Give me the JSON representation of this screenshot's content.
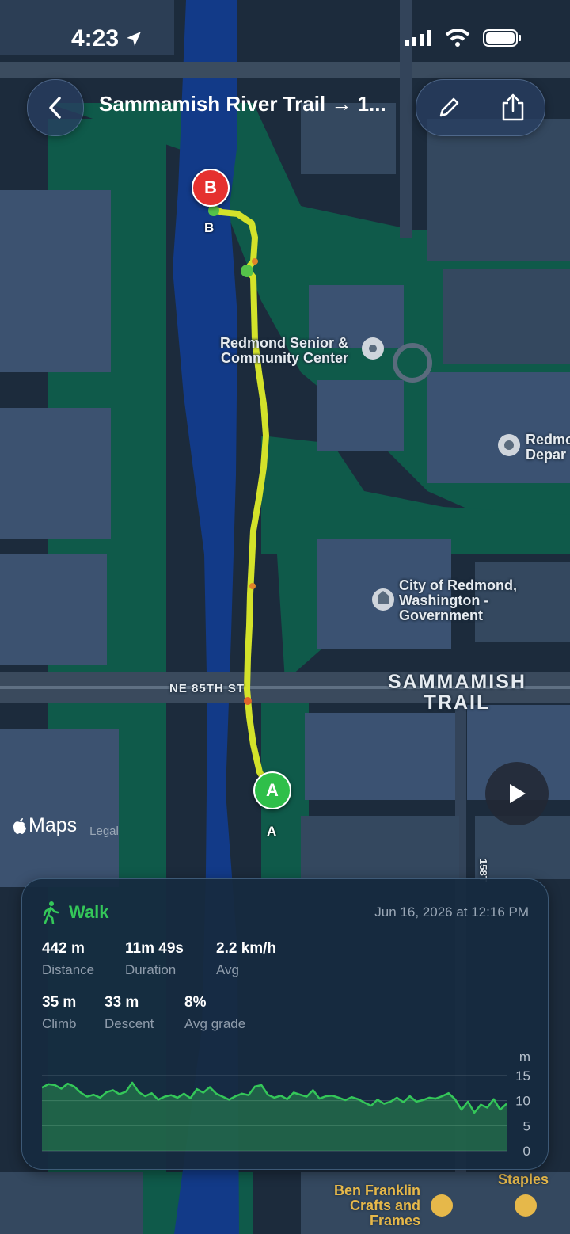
{
  "status_bar": {
    "time": "4:23"
  },
  "header": {
    "title": "Sammamish River Trail → 1..."
  },
  "map": {
    "labels": {
      "senior_center": "Redmond Senior &\nCommunity Center",
      "city_government": "City of Redmond,\nWashington -\nGovernment",
      "police": "Redmo\nDepar",
      "street": "NE 85TH ST",
      "trail": "SAMMAMISH\nTRAIL",
      "street_vertical": "158T",
      "ben_franklin": "Ben Franklin\nCrafts and\nFrames",
      "staples": "Staples"
    },
    "start_marker": "A",
    "end_marker": "B",
    "attribution": {
      "logo": "Maps",
      "legal": "Legal"
    }
  },
  "activity": {
    "type": "Walk",
    "date": "Jun 16, 2026 at 12:16 PM",
    "stats": [
      {
        "value": "442 m",
        "label": "Distance"
      },
      {
        "value": "11m 49s",
        "label": "Duration"
      },
      {
        "value": "2.2 km/h",
        "label": "Avg"
      },
      {
        "value": "35 m",
        "label": "Climb"
      },
      {
        "value": "33 m",
        "label": "Descent"
      },
      {
        "value": "8%",
        "label": "Avg grade"
      }
    ]
  },
  "chart_data": {
    "type": "area",
    "ylabel": "m",
    "ylim": [
      0,
      15
    ],
    "yticks": [
      "15",
      "10",
      "5",
      "0"
    ],
    "values": [
      12.6,
      13.3,
      13.1,
      12.4,
      13.4,
      12.8,
      11.6,
      10.8,
      11.2,
      10.6,
      11.7,
      12.1,
      11.3,
      11.8,
      13.6,
      11.7,
      10.9,
      11.5,
      10.2,
      10.8,
      11.1,
      10.6,
      11.4,
      10.5,
      12.3,
      11.6,
      12.7,
      11.4,
      10.8,
      10.2,
      10.9,
      11.4,
      11.1,
      12.8,
      13.1,
      11.2,
      10.6,
      11.0,
      10.3,
      11.6,
      11.2,
      10.8,
      12.1,
      10.4,
      10.9,
      11.0,
      10.6,
      10.1,
      10.7,
      10.3,
      9.6,
      9.0,
      10.2,
      9.4,
      9.8,
      10.6,
      9.7,
      10.9,
      9.8,
      10.1,
      10.6,
      10.4,
      10.9,
      11.5,
      10.3,
      8.2,
      9.8,
      7.6,
      9.2,
      8.6,
      10.3,
      8.2,
      9.4
    ]
  },
  "colors": {
    "accent_green": "#34c759",
    "marker_red": "#e5312f",
    "route_yellow": "#d3e22a"
  }
}
